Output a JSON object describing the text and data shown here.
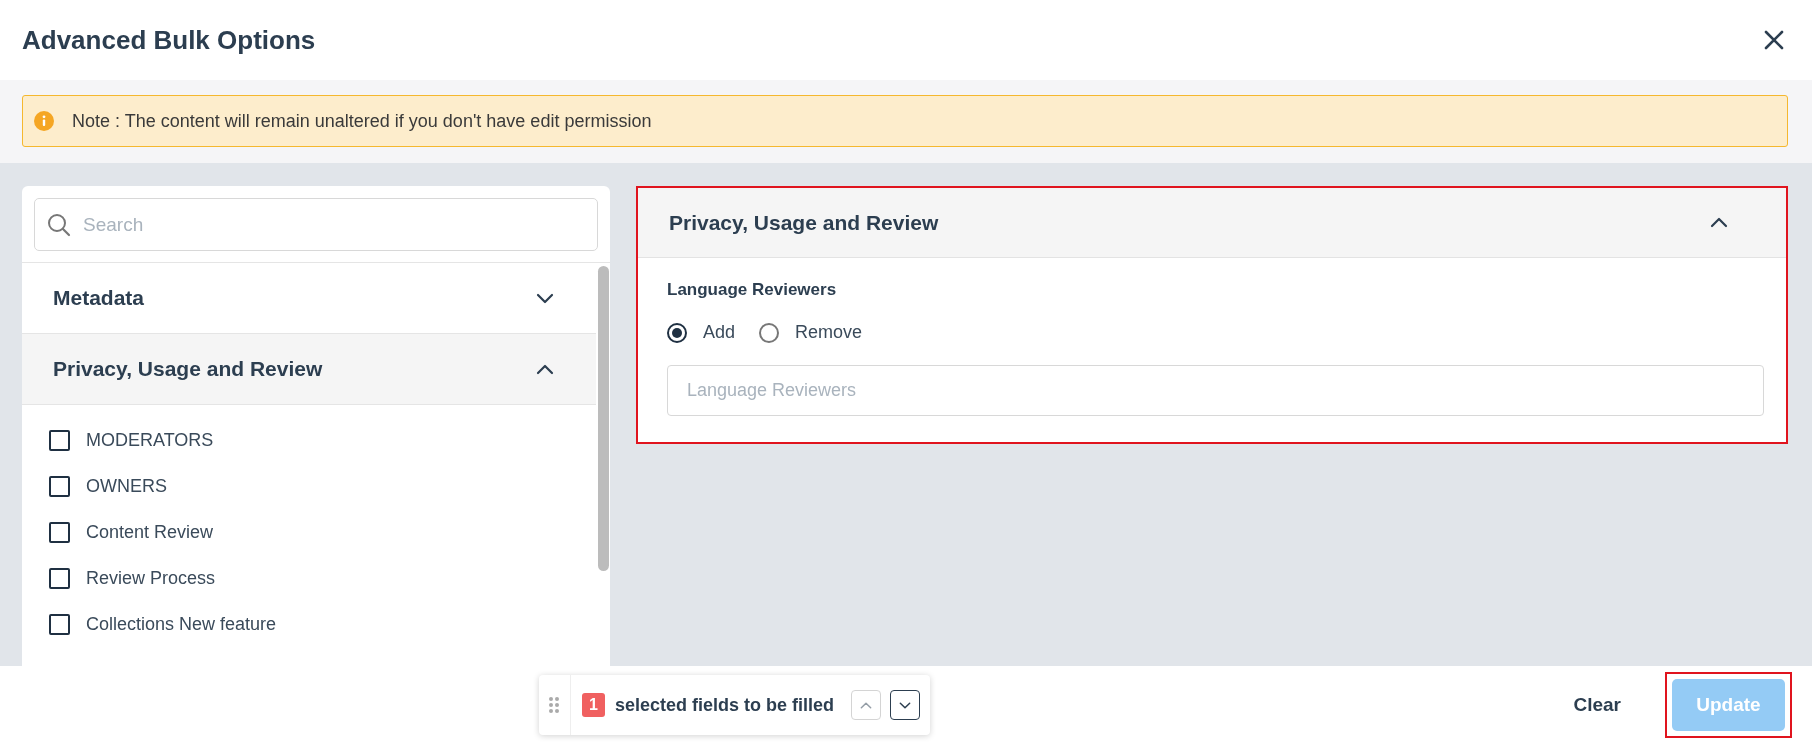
{
  "dialog": {
    "title": "Advanced Bulk Options"
  },
  "note": {
    "text": "Note : The content will remain unaltered if you don't have edit permission"
  },
  "search": {
    "placeholder": "Search"
  },
  "sections": [
    {
      "title": "Metadata",
      "expanded": false
    },
    {
      "title": "Privacy, Usage and Review",
      "expanded": true,
      "fields": [
        {
          "label": "MODERATORS",
          "checked": false
        },
        {
          "label": "OWNERS",
          "checked": false
        },
        {
          "label": "Content Review",
          "checked": false
        },
        {
          "label": "Review Process",
          "checked": false
        },
        {
          "label": "Collections New feature",
          "checked": false
        }
      ]
    }
  ],
  "detail_panel": {
    "title": "Privacy, Usage and Review",
    "expanded": true,
    "highlighted": true,
    "field_label": "Language Reviewers",
    "options": [
      {
        "label": "Add",
        "selected": true
      },
      {
        "label": "Remove",
        "selected": false
      }
    ],
    "input": {
      "placeholder": "Language Reviewers"
    }
  },
  "footer": {
    "count": "1",
    "counter_text": "selected fields to be filled",
    "clear": "Clear",
    "update": {
      "label": "Update",
      "disabled": true,
      "highlighted": true
    }
  }
}
